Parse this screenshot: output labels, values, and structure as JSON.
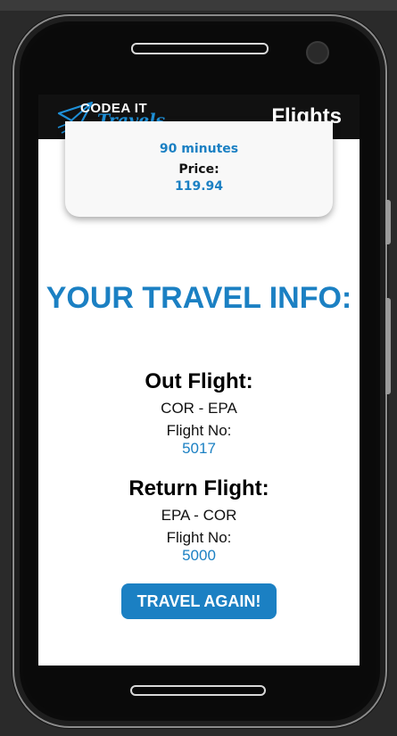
{
  "app": {
    "logo_main": "CODEA IT",
    "logo_sub": "Travels",
    "title": "Flights"
  },
  "summary_card": {
    "duration": "90 minutes",
    "price_label": "Price:",
    "price_value": "119.94"
  },
  "travel_info": {
    "heading": "YOUR TRAVEL INFO:",
    "out_flight": {
      "label": "Out Flight:",
      "route": "COR - EPA",
      "flight_no_label": "Flight No:",
      "flight_no": "5017"
    },
    "return_flight": {
      "label": "Return Flight:",
      "route": "EPA - COR",
      "flight_no_label": "Flight No:",
      "flight_no": "5000"
    },
    "button_label": "TRAVEL AGAIN!"
  },
  "colors": {
    "accent": "#1b80c3",
    "appbar": "#111111",
    "screen": "#ffffff"
  }
}
